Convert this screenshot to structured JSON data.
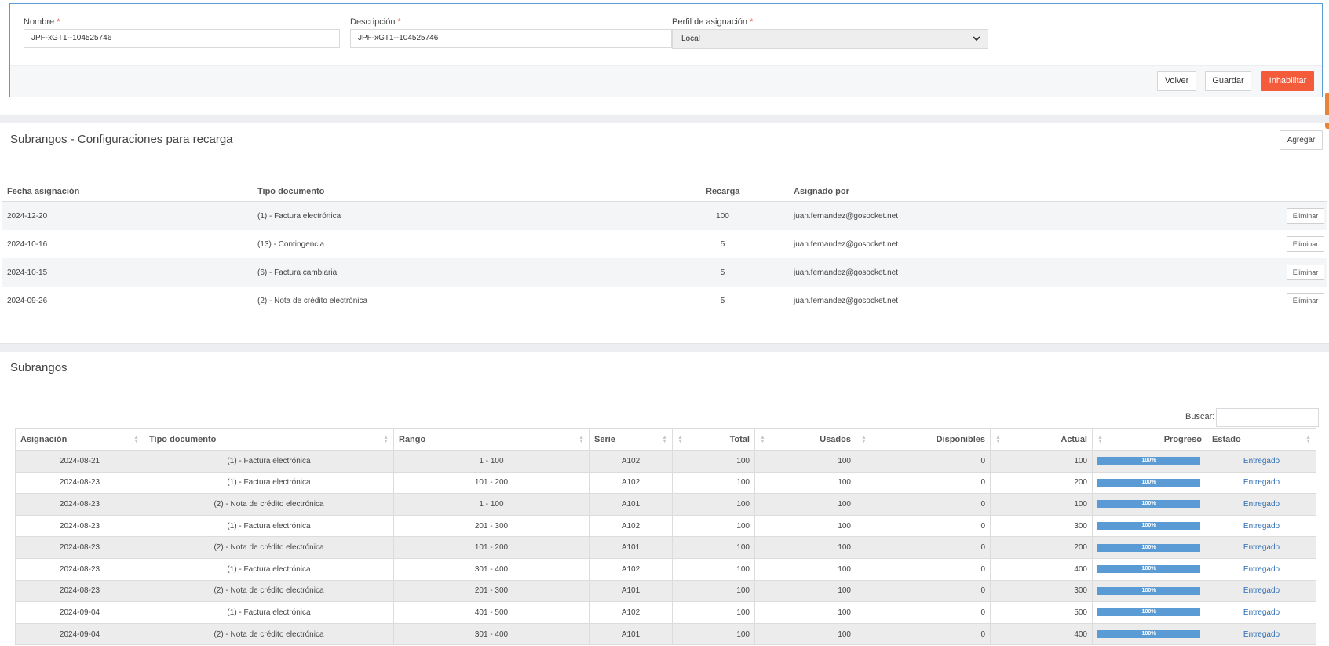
{
  "form": {
    "nombre": {
      "label": "Nombre",
      "value": "JPF-xGT1--104525746"
    },
    "descripcion": {
      "label": "Descripción",
      "value": "JPF-xGT1--104525746"
    },
    "perfil": {
      "label": "Perfil de asignación",
      "value": "Local"
    },
    "required_mark": "*",
    "buttons": {
      "volver": "Volver",
      "guardar": "Guardar",
      "inhabilitar": "Inhabilitar"
    }
  },
  "recarga": {
    "title": "Subrangos - Configuraciones para recarga",
    "add_label": "Agregar",
    "columns": [
      "Fecha asignación",
      "Tipo documento",
      "Recarga",
      "Asignado por"
    ],
    "delete_label": "Eliminar",
    "rows": [
      {
        "fecha": "2024-12-20",
        "tipo": "(1) - Factura electrónica",
        "recarga": "100",
        "asignado": "juan.fernandez@gosocket.net"
      },
      {
        "fecha": "2024-10-16",
        "tipo": "(13) - Contingencia",
        "recarga": "5",
        "asignado": "juan.fernandez@gosocket.net"
      },
      {
        "fecha": "2024-10-15",
        "tipo": "(6) - Factura cambiaria",
        "recarga": "5",
        "asignado": "juan.fernandez@gosocket.net"
      },
      {
        "fecha": "2024-09-26",
        "tipo": "(2) - Nota de crédito electrónica",
        "recarga": "5",
        "asignado": "juan.fernandez@gosocket.net"
      }
    ]
  },
  "subrangos": {
    "title": "Subrangos",
    "search_label": "Buscar:",
    "columns": [
      "Asignación",
      "Tipo documento",
      "Rango",
      "Serie",
      "Total",
      "Usados",
      "Disponibles",
      "Actual",
      "Progreso",
      "Estado"
    ],
    "rows": [
      {
        "asignacion": "2024-08-21",
        "tipo": "(1) - Factura electrónica",
        "rango": "1 - 100",
        "serie": "A102",
        "total": "100",
        "usados": "100",
        "disponibles": "0",
        "actual": "100",
        "progreso": "100%",
        "estado": "Entregado"
      },
      {
        "asignacion": "2024-08-23",
        "tipo": "(1) - Factura electrónica",
        "rango": "101 - 200",
        "serie": "A102",
        "total": "100",
        "usados": "100",
        "disponibles": "0",
        "actual": "200",
        "progreso": "100%",
        "estado": "Entregado"
      },
      {
        "asignacion": "2024-08-23",
        "tipo": "(2) - Nota de crédito electrónica",
        "rango": "1 - 100",
        "serie": "A101",
        "total": "100",
        "usados": "100",
        "disponibles": "0",
        "actual": "100",
        "progreso": "100%",
        "estado": "Entregado"
      },
      {
        "asignacion": "2024-08-23",
        "tipo": "(1) - Factura electrónica",
        "rango": "201 - 300",
        "serie": "A102",
        "total": "100",
        "usados": "100",
        "disponibles": "0",
        "actual": "300",
        "progreso": "100%",
        "estado": "Entregado"
      },
      {
        "asignacion": "2024-08-23",
        "tipo": "(2) - Nota de crédito electrónica",
        "rango": "101 - 200",
        "serie": "A101",
        "total": "100",
        "usados": "100",
        "disponibles": "0",
        "actual": "200",
        "progreso": "100%",
        "estado": "Entregado"
      },
      {
        "asignacion": "2024-08-23",
        "tipo": "(1) - Factura electrónica",
        "rango": "301 - 400",
        "serie": "A102",
        "total": "100",
        "usados": "100",
        "disponibles": "0",
        "actual": "400",
        "progreso": "100%",
        "estado": "Entregado"
      },
      {
        "asignacion": "2024-08-23",
        "tipo": "(2) - Nota de crédito electrónica",
        "rango": "201 - 300",
        "serie": "A101",
        "total": "100",
        "usados": "100",
        "disponibles": "0",
        "actual": "300",
        "progreso": "100%",
        "estado": "Entregado"
      },
      {
        "asignacion": "2024-09-04",
        "tipo": "(1) - Factura electrónica",
        "rango": "401 - 500",
        "serie": "A102",
        "total": "100",
        "usados": "100",
        "disponibles": "0",
        "actual": "500",
        "progreso": "100%",
        "estado": "Entregado"
      },
      {
        "asignacion": "2024-09-04",
        "tipo": "(2) - Nota de crédito electrónica",
        "rango": "301 - 400",
        "serie": "A101",
        "total": "100",
        "usados": "100",
        "disponibles": "0",
        "actual": "400",
        "progreso": "100%",
        "estado": "Entregado"
      }
    ]
  }
}
